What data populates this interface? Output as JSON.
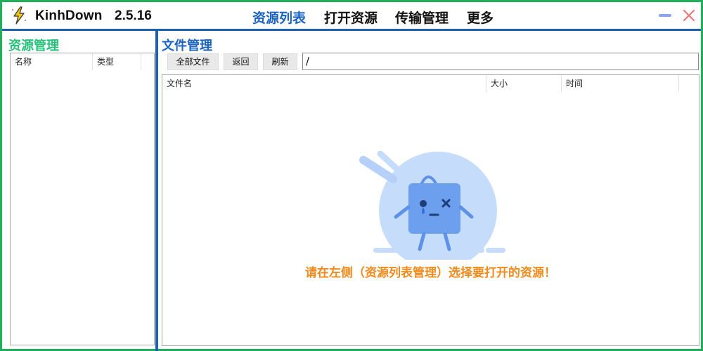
{
  "app": {
    "name": "KinhDown",
    "version": "2.5.16"
  },
  "nav": {
    "items": [
      {
        "label": "资源列表",
        "active": true
      },
      {
        "label": "打开资源",
        "active": false
      },
      {
        "label": "传输管理",
        "active": false
      },
      {
        "label": "更多",
        "active": false
      }
    ]
  },
  "window_controls": {
    "minimize_icon": "minimize-icon",
    "close_icon": "close-icon"
  },
  "resource_panel": {
    "title": "资源管理",
    "columns": [
      "名称",
      "类型"
    ],
    "rows": []
  },
  "file_panel": {
    "title": "文件管理",
    "buttons": {
      "all_files": "全部文件",
      "back": "返回",
      "refresh": "刷新"
    },
    "path": "/",
    "columns": [
      "文件名",
      "大小",
      "时间"
    ],
    "rows": [],
    "empty_message": "请在左侧（资源列表管理）选择要打开的资源！"
  },
  "colors": {
    "window_border": "#1fae5a",
    "accent_blue": "#1a63c2",
    "resource_title_green": "#25c27a",
    "empty_message_orange": "#f08a1a"
  }
}
